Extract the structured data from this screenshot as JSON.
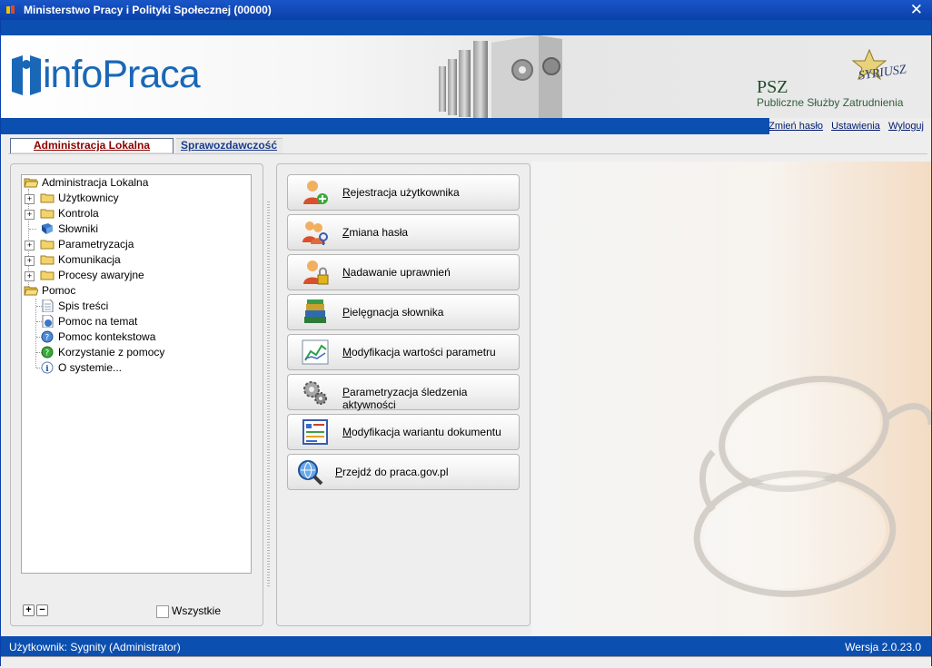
{
  "window": {
    "title": "Ministerstwo Pracy i Polityki Społecznej (00000)",
    "close_label": "✕"
  },
  "brand": {
    "logo_text": "infoPraca",
    "psz_short": "PSZ",
    "psz_full": "Publiczne Służby Zatrudnienia",
    "syriusz": "SYRIUSZ"
  },
  "header_links": {
    "change_password": "Zmień hasło",
    "settings": "Ustawienia",
    "logout": "Wyloguj"
  },
  "tabs": {
    "active": "Administracja Lokalna",
    "other": "Sprawozdawczość"
  },
  "tree": {
    "nodes": [
      {
        "label": "Administracja Lokalna",
        "icon": "folder-open-icon"
      },
      {
        "label": "Użytkownicy",
        "icon": "folder-icon"
      },
      {
        "label": "Kontrola",
        "icon": "folder-icon"
      },
      {
        "label": "Słowniki",
        "icon": "book-icon"
      },
      {
        "label": "Parametryzacja",
        "icon": "folder-icon"
      },
      {
        "label": "Komunikacja",
        "icon": "folder-icon"
      },
      {
        "label": "Procesy awaryjne",
        "icon": "folder-icon"
      },
      {
        "label": "Pomoc",
        "icon": "folder-open-icon"
      },
      {
        "label": "Spis treści",
        "icon": "document-icon"
      },
      {
        "label": "Pomoc na temat",
        "icon": "help-document-icon"
      },
      {
        "label": "Pomoc kontekstowa",
        "icon": "help-circle-icon"
      },
      {
        "label": "Korzystanie z pomocy",
        "icon": "green-help-icon"
      },
      {
        "label": "O systemie...",
        "icon": "info-icon"
      }
    ],
    "expand_all": "+",
    "collapse_all": "−",
    "show_all_label": "Wszystkie",
    "show_all_checked": false
  },
  "actions": [
    {
      "label": "Rejestracja użytkownika",
      "icon": "user-add-icon"
    },
    {
      "label": "Zmiana hasła",
      "icon": "user-key-icon"
    },
    {
      "label": "Nadawanie uprawnień",
      "icon": "user-lock-icon"
    },
    {
      "label": "Pielęgnacja słownika",
      "icon": "books-icon"
    },
    {
      "label": "Modyfikacja wartości parametru",
      "icon": "chart-icon"
    },
    {
      "label": "Parametryzacja śledzenia aktywności",
      "icon": "gears-icon"
    },
    {
      "label": "Modyfikacja wariantu dokumentu",
      "icon": "document-form-icon"
    },
    {
      "label": "Przejdź do praca.gov.pl",
      "icon": "globe-search-icon"
    }
  ],
  "status": {
    "user": "Użytkownik: Sygnity (Administrator)",
    "version": "Wersja 2.0.23.0"
  },
  "colors": {
    "title_blue": "#0b4fb0",
    "brand_blue": "#1a67b8",
    "active_tab_text": "#8b0000"
  }
}
